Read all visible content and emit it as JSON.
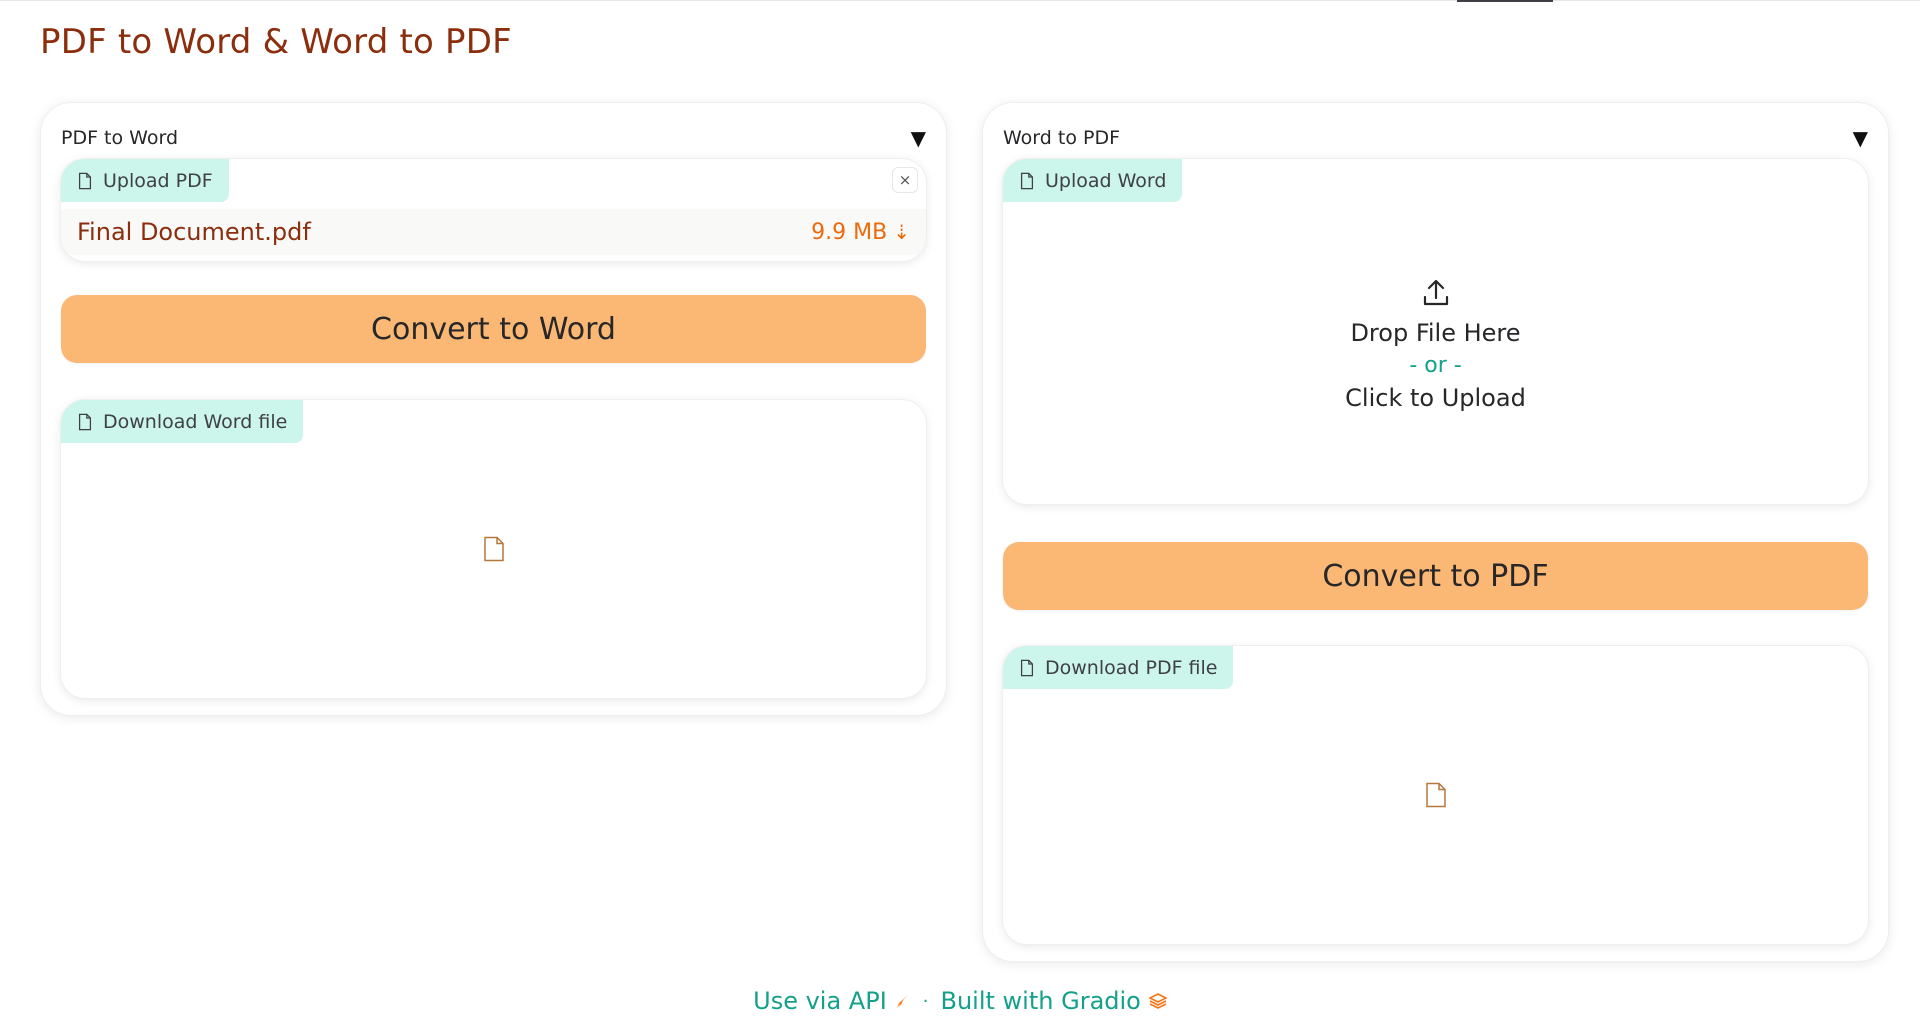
{
  "page": {
    "title": "PDF to Word & Word to PDF"
  },
  "left_panel": {
    "header_label": "PDF to Word",
    "caret_icon": "caret-down-icon",
    "upload": {
      "badge_label": "Upload PDF",
      "file_name": "Final Document.pdf",
      "file_size": "9.9 MB",
      "download_glyph": "⇣",
      "clear_glyph": "×"
    },
    "convert_label": "Convert to Word",
    "download": {
      "badge_label": "Download Word file"
    }
  },
  "right_panel": {
    "header_label": "Word to PDF",
    "upload": {
      "badge_label": "Upload Word",
      "drop_text": "Drop File Here",
      "or_text": "- or -",
      "click_text": "Click to Upload"
    },
    "convert_label": "Convert to PDF",
    "download": {
      "badge_label": "Download PDF file"
    }
  },
  "footer": {
    "api_label": "Use via API",
    "separator": "·",
    "built_label": "Built with Gradio"
  },
  "colors": {
    "title": "#8b2e0e",
    "accent_button": "#fbb875",
    "badge_bg": "#ccf5ec",
    "link": "#14a08a",
    "file_size": "#ea6a0c"
  }
}
